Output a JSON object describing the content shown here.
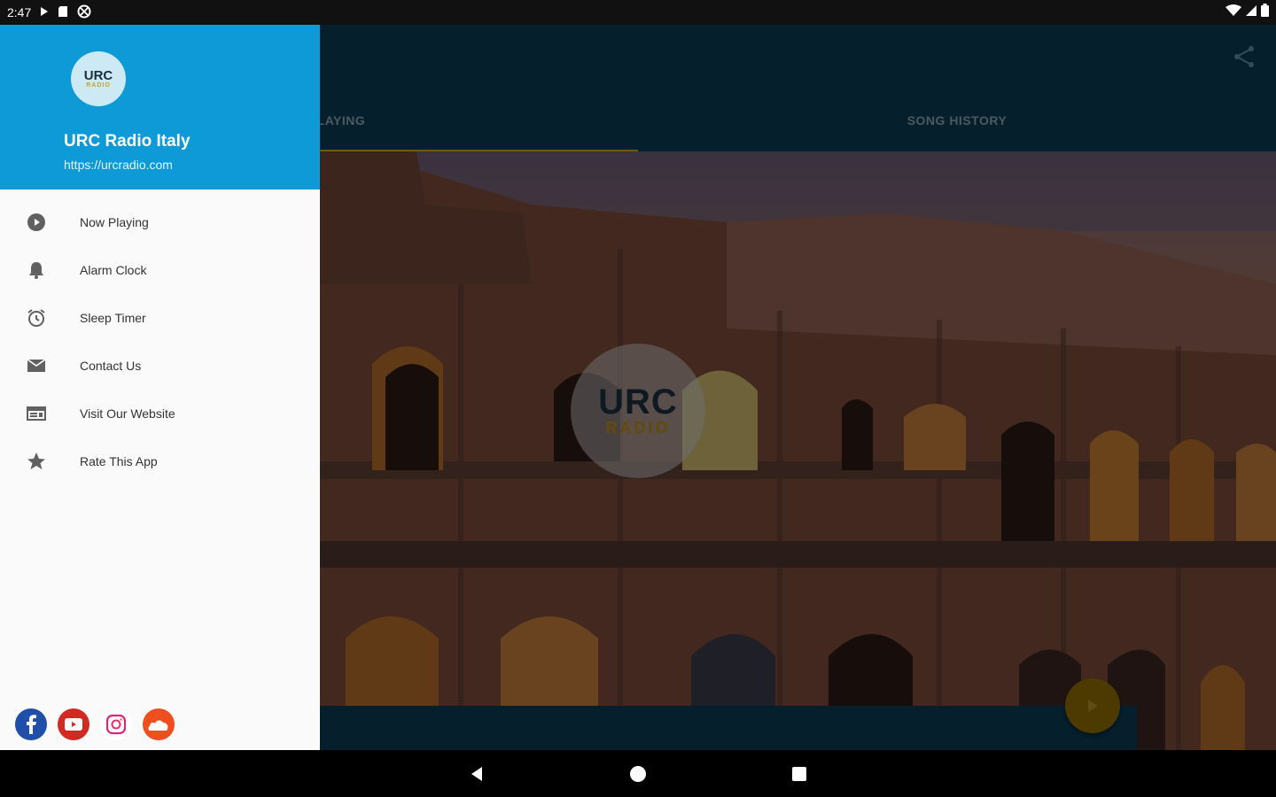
{
  "status_bar": {
    "time": "2:47"
  },
  "tabs": [
    {
      "label": "NOW PLAYING"
    },
    {
      "label": "SONG HISTORY"
    }
  ],
  "logo": {
    "line1": "URC",
    "line2": "RADIO"
  },
  "drawer": {
    "title": "URC Radio Italy",
    "url": "https://urcradio.com",
    "avatar": {
      "line1": "URC",
      "line2": "RADIO"
    },
    "menu": [
      {
        "label": "Now Playing",
        "icon": "play-circle-icon"
      },
      {
        "label": "Alarm Clock",
        "icon": "bell-icon"
      },
      {
        "label": "Sleep Timer",
        "icon": "alarm-clock-icon"
      },
      {
        "label": "Contact Us",
        "icon": "mail-icon"
      },
      {
        "label": "Visit Our Website",
        "icon": "web-icon"
      },
      {
        "label": "Rate This App",
        "icon": "star-icon"
      }
    ],
    "socials": [
      "facebook",
      "youtube",
      "instagram",
      "soundcloud"
    ]
  },
  "colors": {
    "toolbar": "#0b3a52",
    "drawer_header": "#0e9ad6",
    "accent": "#c9a227"
  }
}
